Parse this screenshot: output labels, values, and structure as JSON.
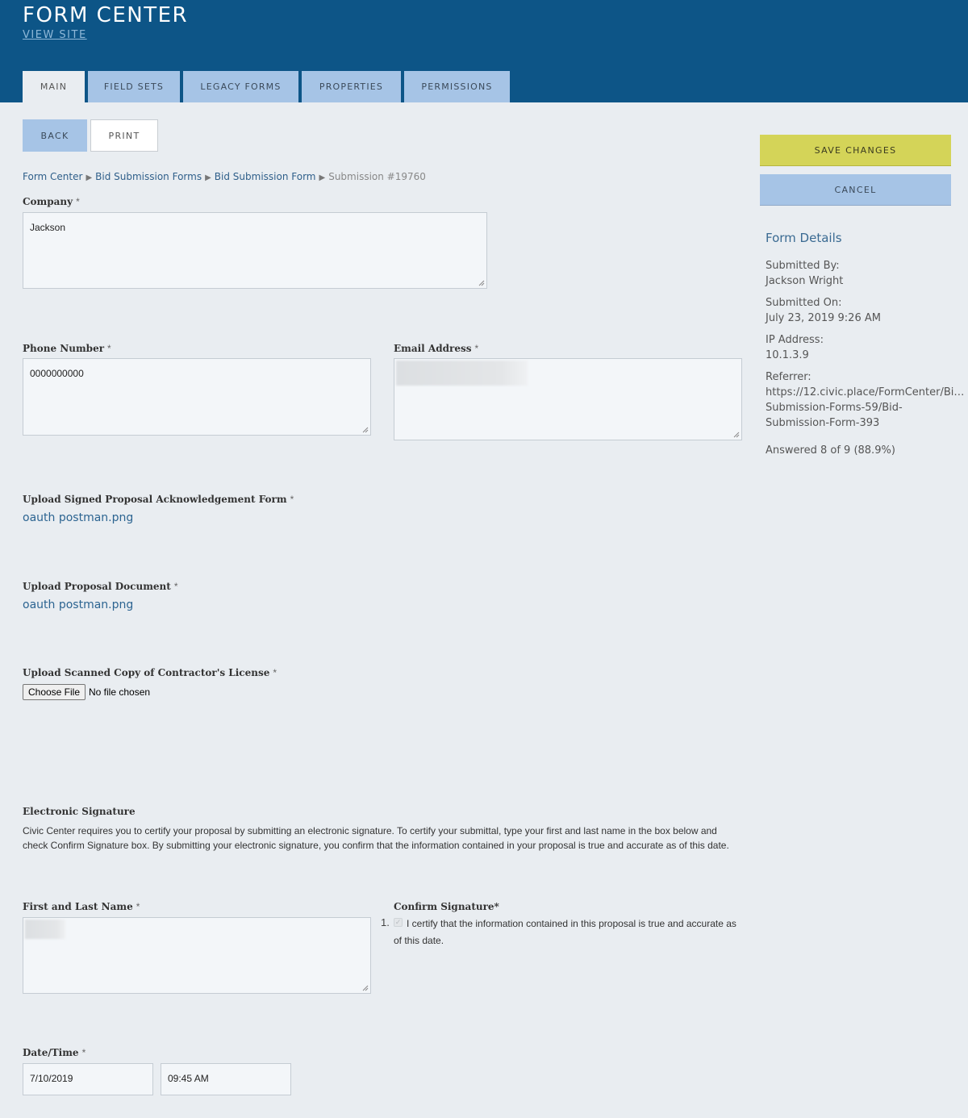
{
  "header": {
    "title": "FORM CENTER",
    "view_site": "VIEW SITE"
  },
  "tabs": [
    {
      "label": "MAIN",
      "active": true
    },
    {
      "label": "FIELD SETS",
      "active": false
    },
    {
      "label": "LEGACY FORMS",
      "active": false
    },
    {
      "label": "PROPERTIES",
      "active": false
    },
    {
      "label": "PERMISSIONS",
      "active": false
    }
  ],
  "toolbar": {
    "back": "BACK",
    "print": "PRINT"
  },
  "breadcrumb": {
    "items": [
      "Form Center",
      "Bid Submission Forms",
      "Bid Submission Form"
    ],
    "current": "Submission #19760",
    "separator": "▶"
  },
  "form": {
    "required_mark": "*",
    "company": {
      "label": "Company",
      "value": "Jackson"
    },
    "phone": {
      "label": "Phone Number",
      "value": "0000000000"
    },
    "email": {
      "label": "Email Address",
      "value": ""
    },
    "upload_ack": {
      "label": "Upload Signed Proposal Acknowledgement Form",
      "file": "oauth postman.png"
    },
    "upload_proposal": {
      "label": "Upload Proposal Document",
      "file": "oauth postman.png"
    },
    "upload_license": {
      "label": "Upload Scanned Copy of Contractor's License",
      "button": "Choose File",
      "status": "No file chosen"
    },
    "esig": {
      "heading": "Electronic Signature",
      "text": "Civic Center requires you to certify your proposal by submitting an electronic signature. To certify your submittal, type your first and last name in the box below and check Confirm Signature box. By submitting your electronic signature, you confirm that the information contained in your proposal is true and accurate as of this date."
    },
    "name": {
      "label": "First and Last Name",
      "value": ""
    },
    "confirm": {
      "label": "Confirm Signature*",
      "number": "1.",
      "checked": true,
      "text": "I certify that the information contained in this proposal is true and accurate as of this date."
    },
    "datetime": {
      "label": "Date/Time",
      "date": "7/10/2019",
      "time": "09:45 AM"
    }
  },
  "sidebar": {
    "save": "SAVE CHANGES",
    "cancel": "CANCEL",
    "details_title": "Form Details",
    "submitted_by_label": "Submitted By:",
    "submitted_by": "Jackson Wright",
    "submitted_on_label": "Submitted On:",
    "submitted_on": "July 23, 2019 9:26 AM",
    "ip_label": "IP Address:",
    "ip": "10.1.3.9",
    "referrer_label": "Referrer:",
    "referrer_lines": [
      "https://12.civic.place/FormCenter/Bi…",
      "Submission-Forms-59/Bid-",
      "Submission-Form-393"
    ],
    "answered": "Answered 8 of 9 (88.9%)"
  },
  "colors": {
    "header": "#0d5587",
    "tab": "#a6c4e6",
    "save": "#d4d458",
    "link": "#2c6491",
    "page": "#e9edf1"
  }
}
